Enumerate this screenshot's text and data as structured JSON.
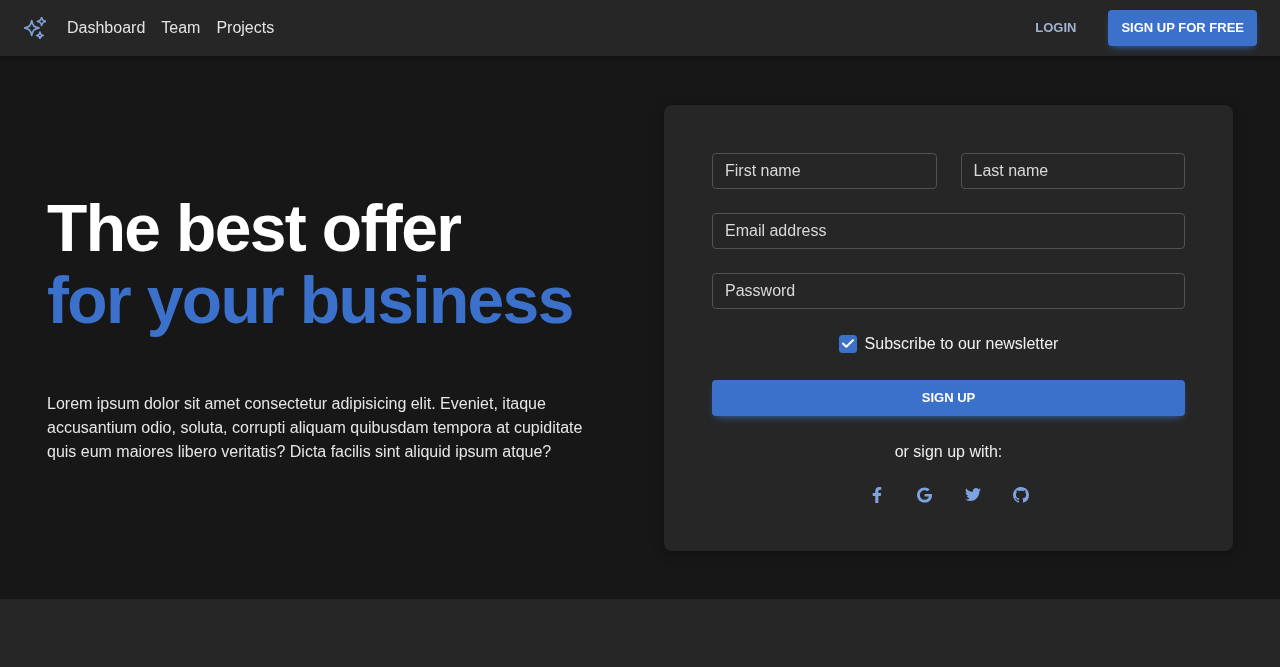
{
  "navbar": {
    "links": [
      {
        "label": "Dashboard"
      },
      {
        "label": "Team"
      },
      {
        "label": "Projects"
      }
    ],
    "login": "LOGIN",
    "signup": "SIGN UP FOR FREE"
  },
  "hero": {
    "title": "The best offer",
    "title_highlight": "for your business",
    "description": "Lorem ipsum dolor sit amet consectetur adipisicing elit. Eveniet, itaque accusantium odio, soluta, corrupti aliquam quibusdam tempora at cupiditate quis eum maiores libero veritatis? Dicta facilis sint aliquid ipsum atque?"
  },
  "form": {
    "field_rows": [
      {
        "fields": [
          {
            "placeholder": "First name"
          },
          {
            "placeholder": "Last name"
          }
        ]
      },
      {
        "fields": [
          {
            "placeholder": "Email address"
          }
        ]
      },
      {
        "fields": [
          {
            "placeholder": "Password"
          }
        ]
      }
    ],
    "newsletter": {
      "label": "Subscribe to our newsletter",
      "checked": true
    },
    "submit": "SIGN UP",
    "social_prompt": "or sign up with:",
    "social": [
      {
        "kind": "facebook"
      },
      {
        "kind": "google"
      },
      {
        "kind": "twitter"
      },
      {
        "kind": "github"
      }
    ]
  }
}
